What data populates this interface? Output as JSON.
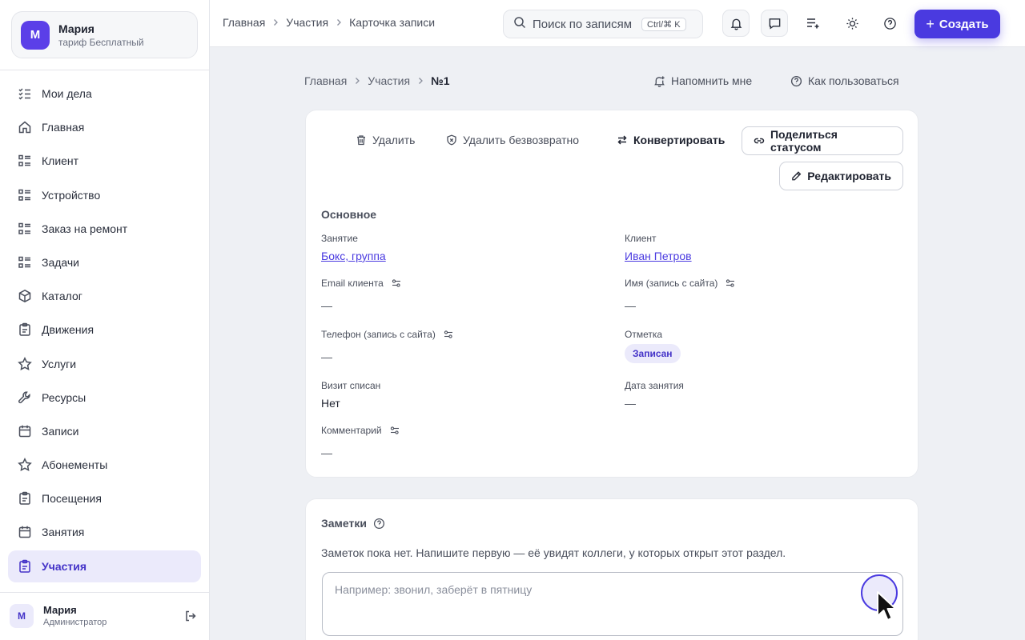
{
  "account": {
    "initial": "М",
    "name": "Мария",
    "plan": "тариф Бесплатный"
  },
  "sidebar": {
    "items": [
      {
        "label": "Мои дела",
        "icon": "checklist-icon",
        "active": false
      },
      {
        "label": "Главная",
        "icon": "home-icon",
        "active": false
      },
      {
        "label": "Клиент",
        "icon": "list-icon",
        "active": false
      },
      {
        "label": "Устройство",
        "icon": "list-icon",
        "active": false
      },
      {
        "label": "Заказ на ремонт",
        "icon": "list-icon",
        "active": false
      },
      {
        "label": "Задачи",
        "icon": "list-icon",
        "active": false
      },
      {
        "label": "Каталог",
        "icon": "box-icon",
        "active": false
      },
      {
        "label": "Движения",
        "icon": "clipboard-icon",
        "active": false
      },
      {
        "label": "Услуги",
        "icon": "star-icon",
        "active": false
      },
      {
        "label": "Ресурсы",
        "icon": "wrench-icon",
        "active": false
      },
      {
        "label": "Записи",
        "icon": "calendar-icon",
        "active": false
      },
      {
        "label": "Абонементы",
        "icon": "star-icon",
        "active": false
      },
      {
        "label": "Посещения",
        "icon": "clipboard-icon",
        "active": false
      },
      {
        "label": "Занятия",
        "icon": "calendar-icon",
        "active": false
      },
      {
        "label": "Участия",
        "icon": "clipboard-icon",
        "active": true
      }
    ]
  },
  "user": {
    "initial": "М",
    "name": "Мария",
    "role": "Администратор"
  },
  "topbar": {
    "crumbs": [
      "Главная",
      "Участия",
      "Карточка записи"
    ],
    "search_placeholder": "Поиск по записям",
    "search_shortcut": "Ctrl/⌘ K",
    "create_label": "Создать"
  },
  "page": {
    "crumbs": [
      "Главная",
      "Участия"
    ],
    "current": "№1",
    "remind_label": "Напомнить мне",
    "howto_label": "Как пользоваться"
  },
  "actions": {
    "delete": "Удалить",
    "delete_forever": "Удалить безвозвратно",
    "convert": "Конвертировать",
    "share": "Поделиться статусом",
    "edit": "Редактировать"
  },
  "record": {
    "section": "Основное",
    "lesson_label": "Занятие",
    "lesson_value": "Бокс, группа",
    "client_label": "Клиент",
    "client_value": "Иван Петров",
    "email_label": "Email клиента",
    "email_value": "—",
    "name_label": "Имя (запись с сайта)",
    "name_value": "—",
    "phone_label": "Телефон (запись с сайта)",
    "phone_value": "—",
    "mark_label": "Отметка",
    "mark_value": "Записан",
    "visit_label": "Визит списан",
    "visit_value": "Нет",
    "date_label": "Дата занятия",
    "date_value": "—",
    "comment_label": "Комментарий",
    "comment_value": "—"
  },
  "notes": {
    "title": "Заметки",
    "empty_text": "Заметок пока нет. Напишите первую — её увидят коллеги, у которых открыт этот раздел.",
    "placeholder": "Например: звонил, заберёт в пятницу"
  },
  "colors": {
    "accent": "#4a3ae0",
    "accent_soft": "#ebeafb",
    "background": "#eef0f4"
  }
}
